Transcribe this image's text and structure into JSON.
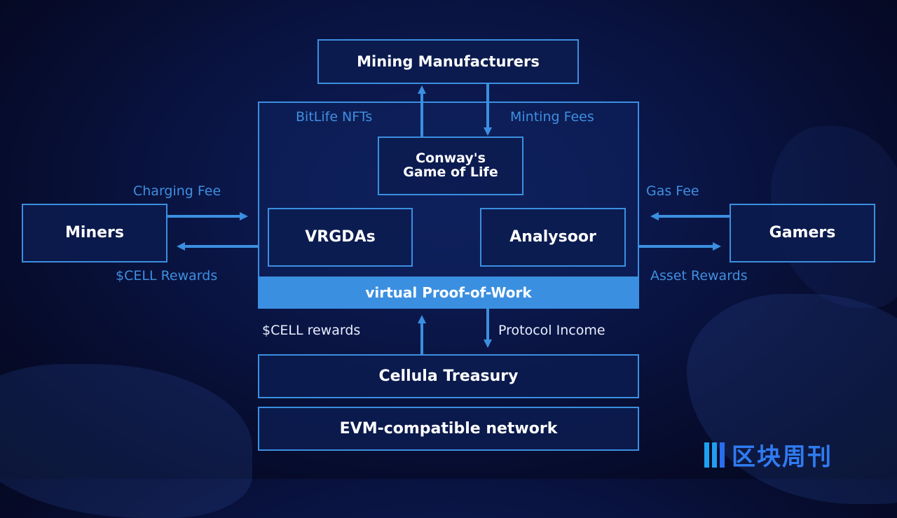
{
  "diagram": {
    "nodes": {
      "mining_manufacturers": "Mining Manufacturers",
      "conways_game_line1": "Conway's",
      "conways_game_line2": "Game of Life",
      "miners": "Miners",
      "vrgdas": "VRGDAs",
      "analysoor": "Analysoor",
      "gamers": "Gamers",
      "virtual_pow": "virtual Proof-of-Work",
      "cellula_treasury": "Cellula Treasury",
      "evm_network": "EVM-compatible network"
    },
    "edges": {
      "bitlife_nfts": "BitLife NFTs",
      "minting_fees": "Minting Fees",
      "charging_fee": "Charging Fee",
      "cell_rewards_miners": "$CELL Rewards",
      "gas_fee": "Gas Fee",
      "asset_rewards": "Asset Rewards",
      "cell_rewards_treasury": "$CELL rewards",
      "protocol_income": "Protocol Income"
    },
    "colors": {
      "accent": "#3b8fe0",
      "background": "#0a1545",
      "node_text": "#ffffff"
    }
  },
  "watermark": {
    "text": "区块周刊"
  }
}
